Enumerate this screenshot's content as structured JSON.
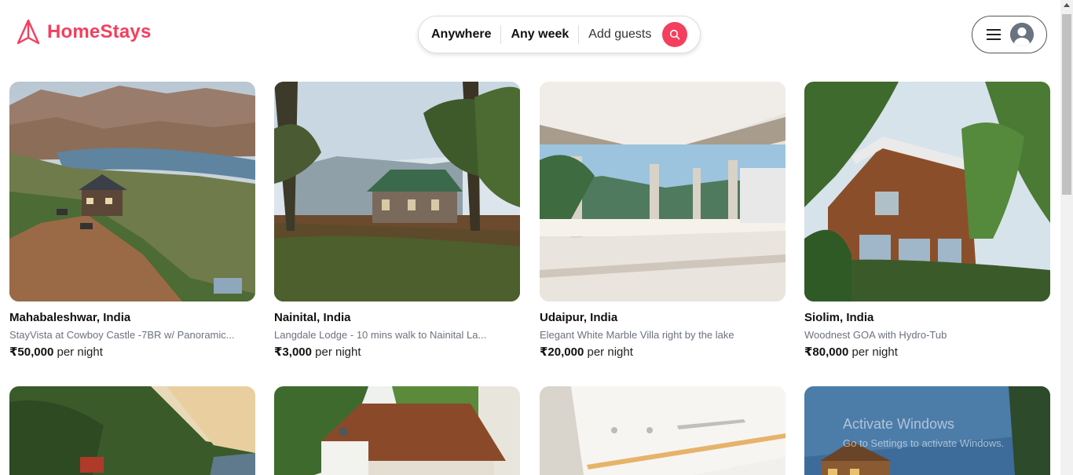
{
  "brand": {
    "name": "HomeStays",
    "color": "#f43f5e",
    "icon": "airbnb-logo-icon"
  },
  "search": {
    "where": "Anywhere",
    "when": "Any week",
    "guests": "Add guests",
    "icon": "search-icon"
  },
  "user_menu": {
    "menu_icon": "hamburger-menu-icon",
    "avatar_icon": "user-avatar-icon"
  },
  "listings": [
    {
      "location": "Mahabaleshwar, India",
      "description": "StayVista at Cowboy Castle -7BR w/ Panoramic...",
      "price": "₹50,000",
      "unit": "per night",
      "image": "mountain-villa-photo"
    },
    {
      "location": "Nainital, India",
      "description": "Langdale Lodge - 10 mins walk to Nainital La...",
      "price": "₹3,000",
      "unit": "per night",
      "image": "forest-lodge-photo"
    },
    {
      "location": "Udaipur, India",
      "description": "Elegant White Marble Villa right by the lake",
      "price": "₹20,000",
      "unit": "per night",
      "image": "marble-villa-lake-photo"
    },
    {
      "location": "Siolim, India",
      "description": "Woodnest GOA with Hydro-Tub",
      "price": "₹80,000",
      "unit": "per night",
      "image": "wooden-house-palms-photo"
    },
    {
      "image": "hillside-sunset-photo"
    },
    {
      "image": "tiled-roof-cottage-photo"
    },
    {
      "image": "modern-interior-photo"
    },
    {
      "image": "chalet-blue-sky-photo"
    }
  ],
  "os_watermark": {
    "title": "Activate Windows",
    "subtitle": "Go to Settings to activate Windows."
  }
}
